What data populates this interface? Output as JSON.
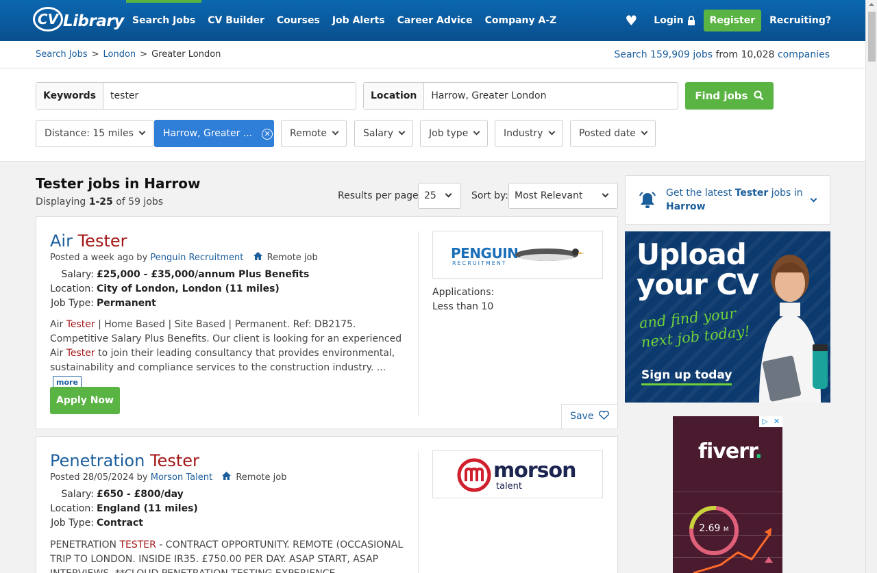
{
  "header": {
    "logo": "CV Library",
    "nav": [
      "Search Jobs",
      "CV Builder",
      "Courses",
      "Job Alerts",
      "Career Advice",
      "Company A-Z"
    ],
    "login": "Login",
    "register": "Register",
    "recruiting": "Recruiting?"
  },
  "breadcrumb": {
    "items": [
      "Search Jobs",
      "London",
      "Greater London"
    ],
    "search_prefix": "Search",
    "jobs_count": "159,909 jobs",
    "from_text": "from 10,028",
    "companies": "companies"
  },
  "search": {
    "keywords_label": "Keywords",
    "keywords_value": "tester",
    "location_label": "Location",
    "location_value": "Harrow, Greater London",
    "find_button": "Find jobs"
  },
  "filters": {
    "distance": "Distance: 15 miles",
    "location_chip": "Harrow, Greater ...",
    "remote": "Remote",
    "salary": "Salary",
    "job_type": "Job type",
    "industry": "Industry",
    "posted_date": "Posted date"
  },
  "results": {
    "title": "Tester jobs in Harrow",
    "displaying_prefix": "Displaying",
    "range": "1-25",
    "of_total": "of 59 jobs",
    "per_page_label": "Results per page:",
    "per_page_value": "25",
    "sort_label": "Sort by:",
    "sort_value": "Most Relevant"
  },
  "jobs": [
    {
      "title_part1": "Air",
      "title_part2": "Tester",
      "posted_prefix": "Posted a week ago by",
      "company": "Penguin Recruitment",
      "remote": "Remote job",
      "salary_label": "Salary:",
      "salary": "£25,000 - £35,000/annum Plus Benefits",
      "location_label": "Location:",
      "location": "City of London, London (11 miles)",
      "jobtype_label": "Job Type:",
      "jobtype": "Permanent",
      "desc_1": "Air ",
      "desc_hl1": "Tester",
      "desc_2": " | Home Based | Site Based | Permanent. Ref: DB2175. Competitive Salary Plus Benefits. Our client is looking for an experienced Air ",
      "desc_hl2": "Tester",
      "desc_3": " to join their leading consultancy that provides environmental, sustainability and compliance services to the construction industry. ...",
      "more": "more",
      "apply": "Apply Now",
      "logo_text": "PENGUIN",
      "logo_sub": "RECRUITMENT",
      "applications_label": "Applications:",
      "applications": "Less than 10",
      "save": "Save"
    },
    {
      "title_part1": "Penetration",
      "title_part2": "Tester",
      "posted_prefix": "Posted 28/05/2024 by",
      "company": "Morson Talent",
      "remote": "Remote job",
      "salary_label": "Salary:",
      "salary": "£650 - £800/day",
      "location_label": "Location:",
      "location": "England (11 miles)",
      "jobtype_label": "Job Type:",
      "jobtype": "Contract",
      "desc_1": "PENETRATION ",
      "desc_hl1": "TESTER",
      "desc_2": " - CONTRACT OPPORTUNITY. REMOTE (OCCASIONAL TRIP TO LONDON. INSIDE IR35. £750.00 PER DAY. ASAP START, ASAP INTERVIEWS. **CLOUD PENETRATION TESTING EXPERIENCE NECCESSARY**. Gain in depth",
      "logo_text": "morson",
      "logo_sub": "talent"
    }
  ],
  "alert": {
    "prefix": "Get the latest",
    "keyword": "Tester",
    "middle": "jobs in",
    "location": "Harrow"
  },
  "ads": {
    "cv": {
      "headline_1": "Upload",
      "headline_2": "your CV",
      "sub_1": "and find your",
      "sub_2": "next job today!",
      "cta": "Sign up today"
    },
    "fiverr": {
      "brand": "fiverr",
      "dot": ".",
      "metric": "2.69",
      "unit": "M"
    }
  },
  "colors": {
    "header_blue": "#0a5aa0",
    "accent_green": "#5ab443",
    "link_blue": "#1b5e9c",
    "highlight_red": "#a31515",
    "chip_blue": "#2f7ed8"
  }
}
